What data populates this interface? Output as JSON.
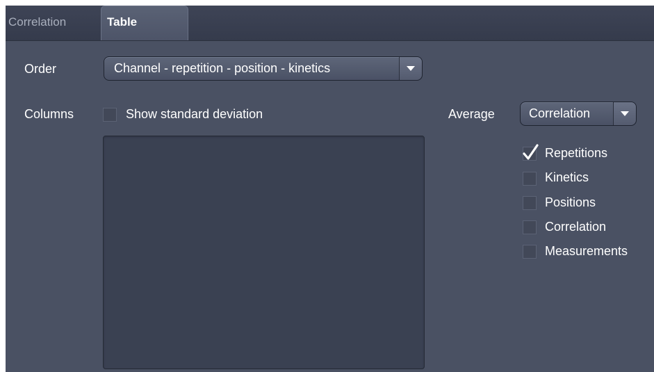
{
  "tabs": [
    {
      "label": "Correlation",
      "active": false
    },
    {
      "label": "Table",
      "active": true
    }
  ],
  "order": {
    "label": "Order",
    "selected": "Channel - repetition - position - kinetics"
  },
  "columns": {
    "label": "Columns",
    "show_std_dev": {
      "label": "Show standard deviation",
      "checked": false
    },
    "list_items": []
  },
  "average": {
    "label": "Average",
    "selected": "Correlation",
    "options": [
      {
        "label": "Repetitions",
        "checked": true
      },
      {
        "label": "Kinetics",
        "checked": false
      },
      {
        "label": "Positions",
        "checked": false
      },
      {
        "label": "Correlation",
        "checked": false
      },
      {
        "label": "Measurements",
        "checked": false
      }
    ]
  },
  "colors": {
    "panel_bg": "#4a5163",
    "tabbar_bg": "#3a4052",
    "list_bg": "#3a4152",
    "text": "#ffffff",
    "inactive_tab_text": "#a9afbd"
  },
  "icons": {
    "dropdown_arrow": "chevron-down-icon",
    "checkmark": "checkmark-icon"
  }
}
